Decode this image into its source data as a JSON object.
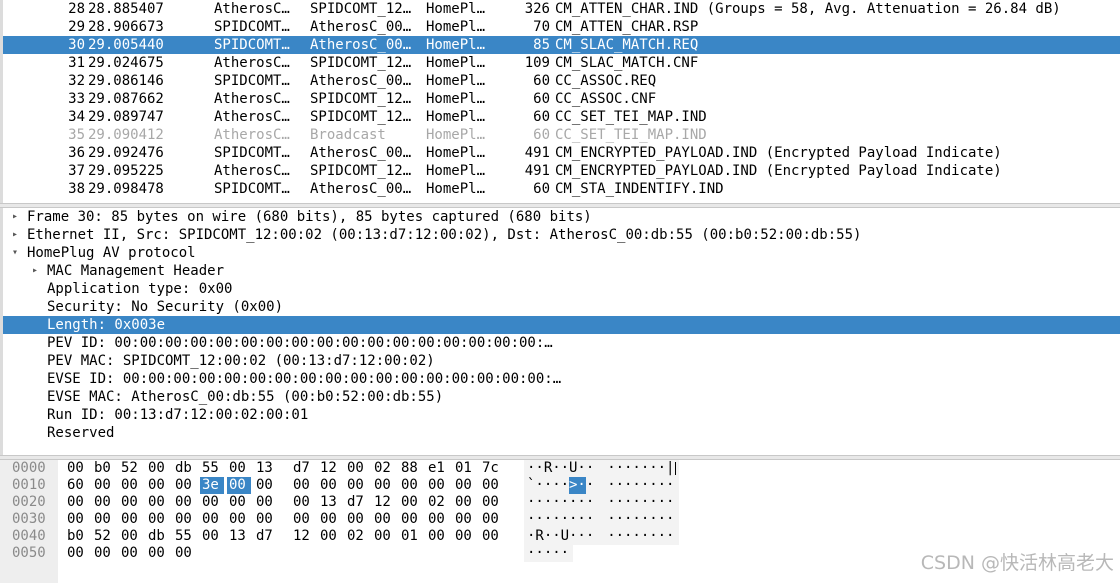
{
  "packet_list": {
    "rows": [
      {
        "no": "28",
        "time": "28.885407",
        "src": "AtherosC…",
        "dst": "SPIDCOMT_12…",
        "proto": "HomePl…",
        "len": "326",
        "info": "CM_ATTEN_CHAR.IND (Groups = 58, Avg. Attenuation = 26.84 dB)",
        "state": "normal"
      },
      {
        "no": "29",
        "time": "28.906673",
        "src": "SPIDCOMT…",
        "dst": "AtherosC_00…",
        "proto": "HomePl…",
        "len": "70",
        "info": "CM_ATTEN_CHAR.RSP",
        "state": "normal"
      },
      {
        "no": "30",
        "time": "29.005440",
        "src": "SPIDCOMT…",
        "dst": "AtherosC_00…",
        "proto": "HomePl…",
        "len": "85",
        "info": "CM_SLAC_MATCH.REQ",
        "state": "selected"
      },
      {
        "no": "31",
        "time": "29.024675",
        "src": "AtherosC…",
        "dst": "SPIDCOMT_12…",
        "proto": "HomePl…",
        "len": "109",
        "info": "CM_SLAC_MATCH.CNF",
        "state": "normal"
      },
      {
        "no": "32",
        "time": "29.086146",
        "src": "SPIDCOMT…",
        "dst": "AtherosC_00…",
        "proto": "HomePl…",
        "len": "60",
        "info": "CC_ASSOC.REQ",
        "state": "normal"
      },
      {
        "no": "33",
        "time": "29.087662",
        "src": "AtherosC…",
        "dst": "SPIDCOMT_12…",
        "proto": "HomePl…",
        "len": "60",
        "info": "CC_ASSOC.CNF",
        "state": "normal"
      },
      {
        "no": "34",
        "time": "29.089747",
        "src": "AtherosC…",
        "dst": "SPIDCOMT_12…",
        "proto": "HomePl…",
        "len": "60",
        "info": "CC_SET_TEI_MAP.IND",
        "state": "normal"
      },
      {
        "no": "35",
        "time": "29.090412",
        "src": "AtherosC…",
        "dst": "Broadcast",
        "proto": "HomePl…",
        "len": "60",
        "info": "CC_SET_TEI_MAP.IND",
        "state": "dim"
      },
      {
        "no": "36",
        "time": "29.092476",
        "src": "SPIDCOMT…",
        "dst": "AtherosC_00…",
        "proto": "HomePl…",
        "len": "491",
        "info": "CM_ENCRYPTED_PAYLOAD.IND (Encrypted Payload Indicate)",
        "state": "normal"
      },
      {
        "no": "37",
        "time": "29.095225",
        "src": "AtherosC…",
        "dst": "SPIDCOMT_12…",
        "proto": "HomePl…",
        "len": "491",
        "info": "CM_ENCRYPTED_PAYLOAD.IND (Encrypted Payload Indicate)",
        "state": "normal"
      },
      {
        "no": "38",
        "time": "29.098478",
        "src": "SPIDCOMT…",
        "dst": "AtherosC_00…",
        "proto": "HomePl…",
        "len": "60",
        "info": "CM_STA_INDENTIFY.IND",
        "state": "normal"
      }
    ]
  },
  "details": {
    "rows": [
      {
        "level": 0,
        "arrow": "collapsed",
        "text": "Frame 30: 85 bytes on wire (680 bits), 85 bytes captured (680 bits)",
        "selected": false
      },
      {
        "level": 0,
        "arrow": "collapsed",
        "text": "Ethernet II, Src: SPIDCOMT_12:00:02 (00:13:d7:12:00:02), Dst: AtherosC_00:db:55 (00:b0:52:00:db:55)",
        "selected": false
      },
      {
        "level": 0,
        "arrow": "expanded",
        "text": "HomePlug AV protocol",
        "selected": false
      },
      {
        "level": 1,
        "arrow": "collapsed",
        "text": "MAC Management Header",
        "selected": false
      },
      {
        "level": 1,
        "arrow": "none",
        "text": "Application type: 0x00",
        "selected": false
      },
      {
        "level": 1,
        "arrow": "none",
        "text": "Security: No Security (0x00)",
        "selected": false
      },
      {
        "level": 1,
        "arrow": "none",
        "text": "Length: 0x003e",
        "selected": true
      },
      {
        "level": 1,
        "arrow": "none",
        "text": "PEV ID: 00:00:00:00:00:00:00:00:00:00:00:00:00:00:00:00:00:…",
        "selected": false
      },
      {
        "level": 1,
        "arrow": "none",
        "text": "PEV MAC: SPIDCOMT_12:00:02 (00:13:d7:12:00:02)",
        "selected": false
      },
      {
        "level": 1,
        "arrow": "none",
        "text": "EVSE ID: 00:00:00:00:00:00:00:00:00:00:00:00:00:00:00:00:00:…",
        "selected": false
      },
      {
        "level": 1,
        "arrow": "none",
        "text": "EVSE MAC: AtherosC_00:db:55 (00:b0:52:00:db:55)",
        "selected": false
      },
      {
        "level": 1,
        "arrow": "none",
        "text": "Run ID: 00:13:d7:12:00:02:00:01",
        "selected": false
      },
      {
        "level": 1,
        "arrow": "none",
        "text": "Reserved",
        "selected": false
      }
    ]
  },
  "hex_dump": {
    "rows": [
      {
        "offset": "0000",
        "bytes": [
          "00",
          "b0",
          "52",
          "00",
          "db",
          "55",
          "00",
          "13",
          "d7",
          "12",
          "00",
          "02",
          "88",
          "e1",
          "01",
          "7c"
        ],
        "ascii": [
          "·",
          "·",
          "R",
          "·",
          "·",
          "U",
          "·",
          "·",
          "·",
          "·",
          "·",
          "·",
          "·",
          "·",
          "·",
          "|"
        ]
      },
      {
        "offset": "0010",
        "bytes": [
          "60",
          "00",
          "00",
          "00",
          "00",
          "3e",
          "00",
          "00",
          "00",
          "00",
          "00",
          "00",
          "00",
          "00",
          "00",
          "00"
        ],
        "ascii": [
          "`",
          "·",
          "·",
          "·",
          "·",
          ">",
          "·",
          "·",
          "·",
          "·",
          "·",
          "·",
          "·",
          "·",
          "·",
          "·"
        ],
        "highlight": [
          5,
          6
        ]
      },
      {
        "offset": "0020",
        "bytes": [
          "00",
          "00",
          "00",
          "00",
          "00",
          "00",
          "00",
          "00",
          "00",
          "13",
          "d7",
          "12",
          "00",
          "02",
          "00",
          "00"
        ],
        "ascii": [
          "·",
          "·",
          "·",
          "·",
          "·",
          "·",
          "·",
          "·",
          "·",
          "·",
          "·",
          "·",
          "·",
          "·",
          "·",
          "·"
        ]
      },
      {
        "offset": "0030",
        "bytes": [
          "00",
          "00",
          "00",
          "00",
          "00",
          "00",
          "00",
          "00",
          "00",
          "00",
          "00",
          "00",
          "00",
          "00",
          "00",
          "00"
        ],
        "ascii": [
          "·",
          "·",
          "·",
          "·",
          "·",
          "·",
          "·",
          "·",
          "·",
          "·",
          "·",
          "·",
          "·",
          "·",
          "·",
          "·"
        ]
      },
      {
        "offset": "0040",
        "bytes": [
          "b0",
          "52",
          "00",
          "db",
          "55",
          "00",
          "13",
          "d7",
          "12",
          "00",
          "02",
          "00",
          "01",
          "00",
          "00",
          "00"
        ],
        "ascii": [
          "·",
          "R",
          "·",
          "·",
          "U",
          "·",
          "·",
          "·",
          "·",
          "·",
          "·",
          "·",
          "·",
          "·",
          "·",
          "·"
        ]
      },
      {
        "offset": "0050",
        "bytes": [
          "00",
          "00",
          "00",
          "00",
          "00"
        ],
        "ascii": [
          "·",
          "·",
          "·",
          "·",
          "·"
        ]
      }
    ]
  },
  "watermark": "CSDN @快活林高老大",
  "colors": {
    "selection": "#3a86c6",
    "dim_text": "#a8a8a8",
    "offset_text": "#8a8a8a"
  }
}
